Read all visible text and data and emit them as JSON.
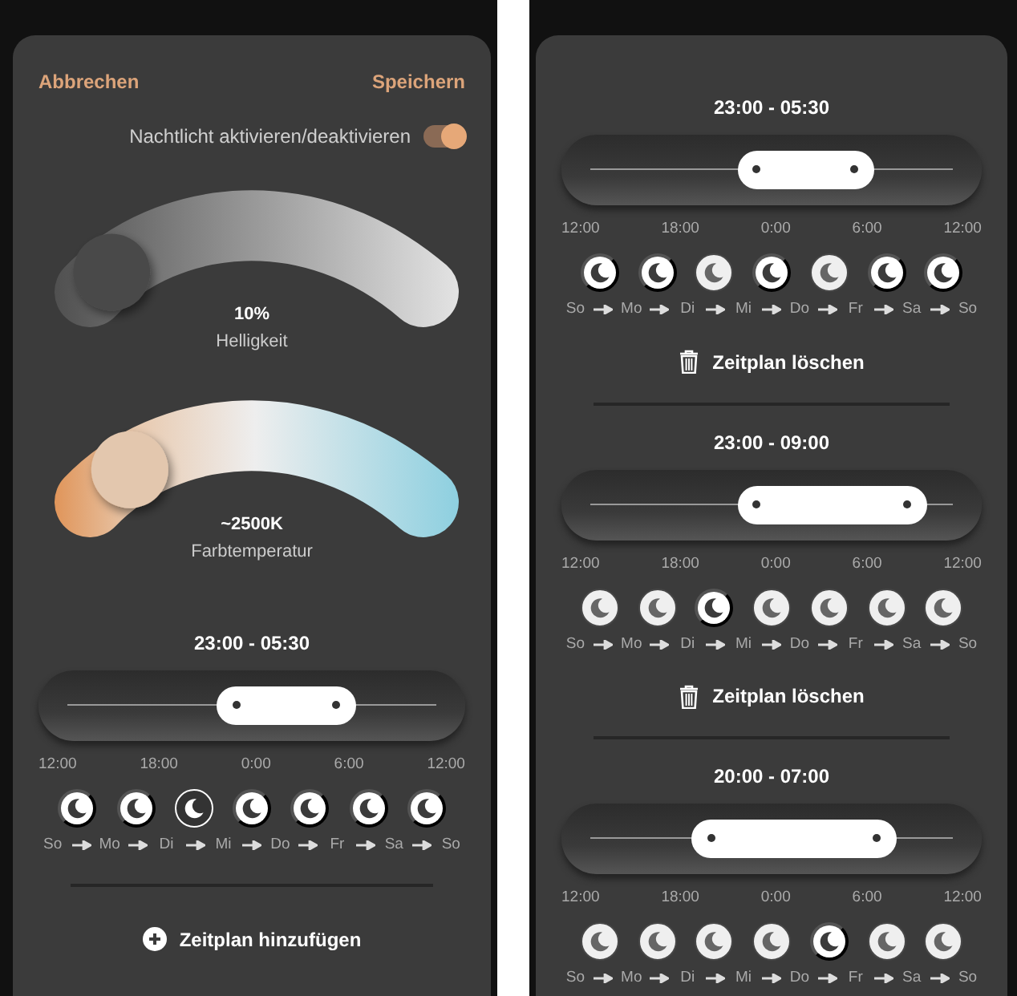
{
  "left_panel": {
    "cancel": "Abbrechen",
    "save": "Speichern",
    "toggle": {
      "label": "Nachtlicht aktivieren/deaktivieren",
      "on": true
    },
    "brightness": {
      "value": "10%",
      "label": "Helligkeit",
      "level": 0.08
    },
    "color_temperature": {
      "value": "~2500K",
      "label": "Farbtemperatur",
      "level": 0.14
    },
    "schedules": [
      {
        "time": "23:00 - 05:30",
        "handles": [
          {
            "level": 0.458
          },
          {
            "level": 0.729
          }
        ],
        "ticks": [
          "12:00",
          "18:00",
          "0:00",
          "6:00",
          "12:00"
        ],
        "days": [
          "So",
          "Mo",
          "Di",
          "Mi",
          "Do",
          "Fr",
          "Sa",
          "So"
        ],
        "nights": [
          {
            "kind": "on"
          },
          {
            "kind": "on"
          },
          {
            "kind": "ring"
          },
          {
            "kind": "on"
          },
          {
            "kind": "on"
          },
          {
            "kind": "on"
          },
          {
            "kind": "on"
          }
        ]
      }
    ],
    "add_button": "Zeitplan hinzufügen"
  },
  "right_panel": {
    "schedules": [
      {
        "time": "23:00 - 05:30",
        "handles": [
          {
            "level": 0.458
          },
          {
            "level": 0.729
          }
        ],
        "ticks": [
          "12:00",
          "18:00",
          "0:00",
          "6:00",
          "12:00"
        ],
        "days": [
          "So",
          "Mo",
          "Di",
          "Mi",
          "Do",
          "Fr",
          "Sa",
          "So"
        ],
        "nights": [
          {
            "kind": "on"
          },
          {
            "kind": "on"
          },
          {
            "kind": "off"
          },
          {
            "kind": "on"
          },
          {
            "kind": "off"
          },
          {
            "kind": "on"
          },
          {
            "kind": "on"
          }
        ],
        "delete_button": "Zeitplan löschen"
      },
      {
        "time": "23:00 - 09:00",
        "handles": [
          {
            "level": 0.458
          },
          {
            "level": 0.875
          }
        ],
        "ticks": [
          "12:00",
          "18:00",
          "0:00",
          "6:00",
          "12:00"
        ],
        "days": [
          "So",
          "Mo",
          "Di",
          "Mi",
          "Do",
          "Fr",
          "Sa",
          "So"
        ],
        "nights": [
          {
            "kind": "off"
          },
          {
            "kind": "off"
          },
          {
            "kind": "on"
          },
          {
            "kind": "off"
          },
          {
            "kind": "off"
          },
          {
            "kind": "off"
          },
          {
            "kind": "off"
          }
        ],
        "delete_button": "Zeitplan löschen"
      },
      {
        "time": "20:00 - 07:00",
        "handles": [
          {
            "level": 0.333
          },
          {
            "level": 0.792
          }
        ],
        "ticks": [
          "12:00",
          "18:00",
          "0:00",
          "6:00",
          "12:00"
        ],
        "days": [
          "So",
          "Mo",
          "Di",
          "Mi",
          "Do",
          "Fr",
          "Sa",
          "So"
        ],
        "nights": [
          {
            "kind": "off"
          },
          {
            "kind": "off"
          },
          {
            "kind": "off"
          },
          {
            "kind": "off"
          },
          {
            "kind": "on"
          },
          {
            "kind": "off"
          },
          {
            "kind": "off"
          }
        ]
      }
    ]
  }
}
